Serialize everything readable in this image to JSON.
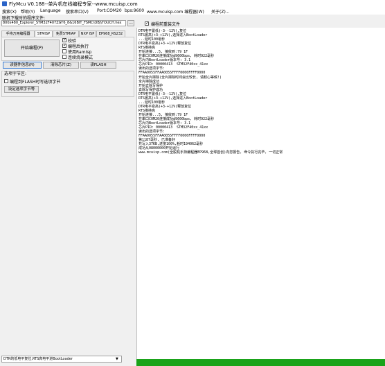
{
  "window": {
    "title": "FlyMcu V0.188--单片机在线编程专家--www.mcuisp.com"
  },
  "menu": {
    "items": [
      "搜索(X)",
      "帮助(Y)",
      "Language",
      "搜索串口(V)",
      "Port:COM20",
      "bps:9600",
      "www.mcuisp.com 编程器(W)",
      "关于(Z)..."
    ]
  },
  "file": {
    "label": "联机下载时的程序文件:",
    "path": "800x480_Explorer_STM32F407ZGT6_8&16BIT_FSMC\\OBJ\\TOUCH.hex",
    "browse_label": "...",
    "reload_label": "编程前重装文件",
    "reload_checked": true
  },
  "tabs": [
    "手持万用编程器",
    "STMISP",
    "免费STMIAP",
    "NXP ISP",
    "EP968_RS232"
  ],
  "active_tab_index": 1,
  "actions": {
    "start_label": "开始编程(P)",
    "options": [
      {
        "label": "校验",
        "checked": true
      },
      {
        "label": "编程后执行",
        "checked": true
      },
      {
        "label": "使用RamIsp",
        "checked": false
      },
      {
        "label": "连续烧录模式",
        "checked": false
      }
    ],
    "read_info_label": "读器件信息(R)",
    "erase_label": "清除芯片(Z)",
    "read_flash_label": "读FLASH"
  },
  "option_bytes": {
    "group_label": "选项字节区:",
    "checkbox_label": "编程到FLASH时写选项字节",
    "checked": false,
    "set_button_label": "设定选项字节等"
  },
  "log": [
    "DTR电平置低(-3--12V),复位",
    "RTS置高(+3-+12V),选择进入BootLoader",
    "...延时100毫秒",
    "DTR电平变高(+3-+12V)释放复位",
    "RTS维持高",
    "开始连接...5, 接收到:79 1F",
    "在串口COM20连接成功@9600bps, 耗时922毫秒",
    "芯片内BootLoader版本号: 3.1",
    "芯片PID: 00000413  STM32F40xx_41xx",
    "读出的选项字节:",
    "FFAA0055FFAA0055FFFF0000FFFF0000",
    "开始全片擦除(全片擦除时间会比较长, 请耐心等候!)",
    "全片擦除成功",
    "开始去除写保护",
    "去除写保护成功",
    "DTR电平置低(-3--12V),复位",
    "RTS置高(+3-+12V),选择进入BootLoader",
    "...延时100毫秒",
    "DTR电平变高(+3-+12V)释放复位",
    "RTS维持高",
    "开始连接...5, 接收到:79 1F",
    "在串口COM20连接成功@9600bps, 耗时922毫秒",
    "芯片内BootLoader版本号: 3.1",
    "芯片PID: 00000413  STM32F40xx_41xx",
    "读出的选项字节:",
    "FFAA0055FFAA0055FFFF0000FFFF0000",
    "第1187毫秒, 已准备好",
    "共写入37KB,进度100%,耗时194062毫秒",
    "成功从08000000开始运行",
    "www.mcuisp.com(全脱机手持编程器EP968,全球首创)向您报告, 命令执行完毕, 一切正常"
  ],
  "status": {
    "mode_select": "DTR的低电平复位,RTS高电平进BootLoader",
    "progress": 1.0,
    "progress_color": "#1aa31a"
  }
}
